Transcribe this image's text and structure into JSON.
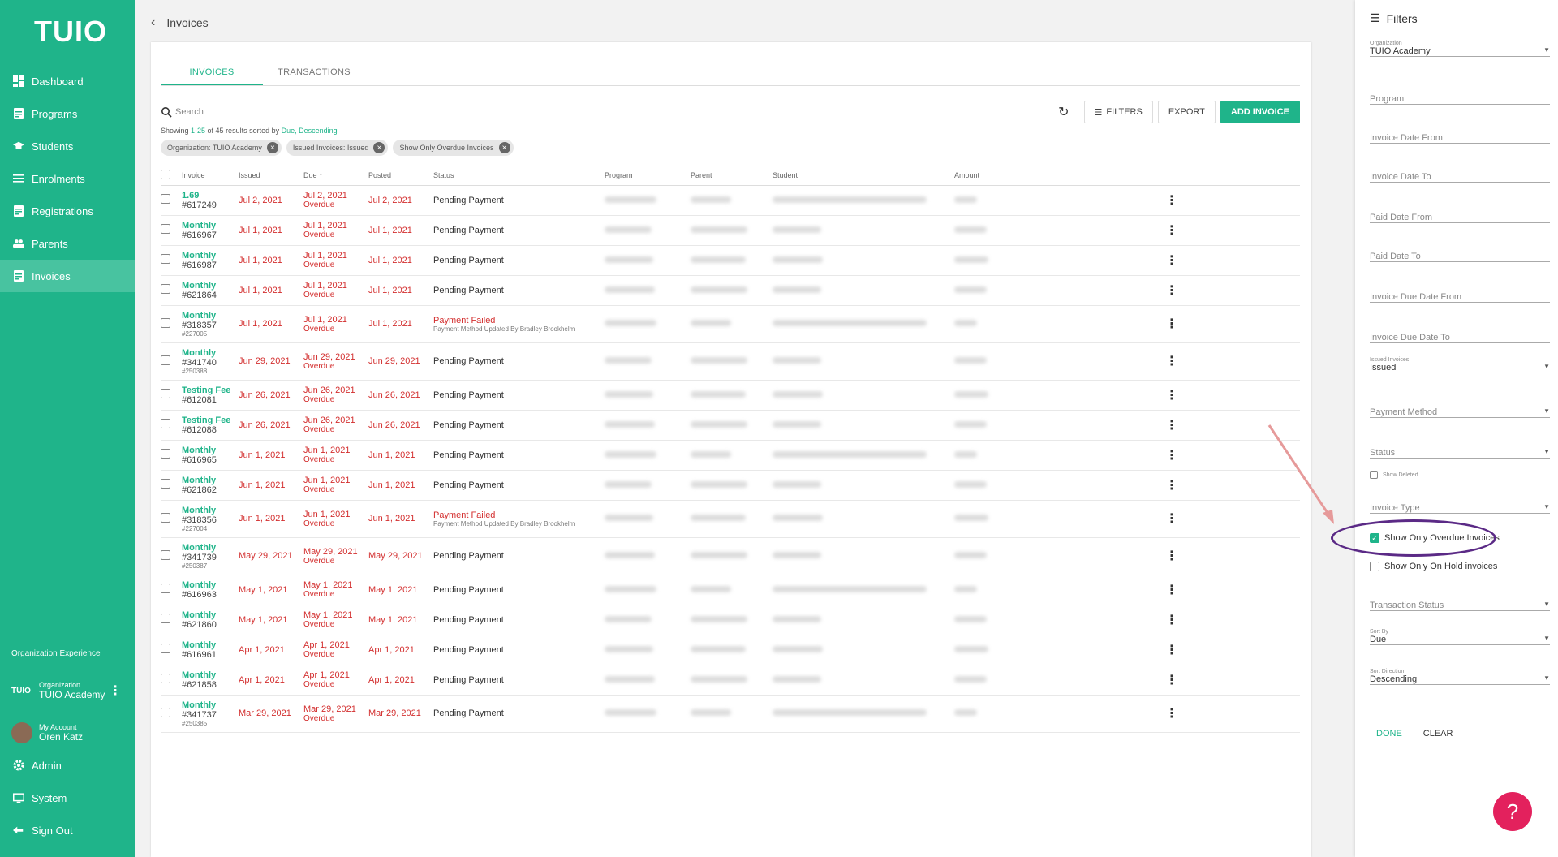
{
  "app": {
    "logo": "TUIO",
    "page_title": "Invoices"
  },
  "sidebar": {
    "items": [
      {
        "label": "Dashboard",
        "icon": "dashboard-icon"
      },
      {
        "label": "Programs",
        "icon": "document-icon"
      },
      {
        "label": "Students",
        "icon": "graduation-cap-icon"
      },
      {
        "label": "Enrolments",
        "icon": "list-icon"
      },
      {
        "label": "Registrations",
        "icon": "document-icon"
      },
      {
        "label": "Parents",
        "icon": "people-icon"
      },
      {
        "label": "Invoices",
        "icon": "document-icon",
        "active": true
      }
    ],
    "org_heading": "Organization Experience",
    "org_logo": "TUIO",
    "org_label": "Organization",
    "org_name": "TUIO Academy",
    "account_label": "My Account",
    "account_name": "Oren Katz",
    "bottom": [
      {
        "label": "Admin",
        "icon": "gear-icon"
      },
      {
        "label": "System",
        "icon": "monitor-icon"
      },
      {
        "label": "Sign Out",
        "icon": "sign-out-icon"
      }
    ]
  },
  "tabs": [
    "INVOICES",
    "TRANSACTIONS"
  ],
  "toolbar": {
    "search_placeholder": "Search",
    "filters": "FILTERS",
    "export": "EXPORT",
    "add_invoice": "ADD INVOICE"
  },
  "showing": {
    "prefix": "Showing ",
    "range": "1-25",
    "mid": " of 45 results sorted by ",
    "sort": "Due, Descending"
  },
  "chips": [
    "Organization: TUIO Academy",
    "Issued Invoices: Issued",
    "Show Only Overdue Invoices"
  ],
  "columns": [
    "Invoice",
    "Issued",
    "Due",
    "Posted",
    "Status",
    "Program",
    "Parent",
    "Student",
    "Amount"
  ],
  "due_sort_arrow": "↑",
  "overdue_label": "Overdue",
  "rows": [
    {
      "type": "1.69",
      "num": "#617249",
      "sub": "",
      "issued": "Jul 2, 2021",
      "due": "Jul 2, 2021",
      "posted": "Jul 2, 2021",
      "status": "Pending Payment",
      "status_sub": ""
    },
    {
      "type": "Monthly",
      "num": "#616967",
      "sub": "",
      "issued": "Jul 1, 2021",
      "due": "Jul 1, 2021",
      "posted": "Jul 1, 2021",
      "status": "Pending Payment",
      "status_sub": ""
    },
    {
      "type": "Monthly",
      "num": "#616987",
      "sub": "",
      "issued": "Jul 1, 2021",
      "due": "Jul 1, 2021",
      "posted": "Jul 1, 2021",
      "status": "Pending Payment",
      "status_sub": ""
    },
    {
      "type": "Monthly",
      "num": "#621864",
      "sub": "",
      "issued": "Jul 1, 2021",
      "due": "Jul 1, 2021",
      "posted": "Jul 1, 2021",
      "status": "Pending Payment",
      "status_sub": ""
    },
    {
      "type": "Monthly",
      "num": "#318357",
      "sub": "#227005",
      "issued": "Jul 1, 2021",
      "due": "Jul 1, 2021",
      "posted": "Jul 1, 2021",
      "status": "Payment Failed",
      "status_sub": "Payment Method Updated By Bradley Brookhelm"
    },
    {
      "type": "Monthly",
      "num": "#341740",
      "sub": "#250388",
      "issued": "Jun 29, 2021",
      "due": "Jun 29, 2021",
      "posted": "Jun 29, 2021",
      "status": "Pending Payment",
      "status_sub": ""
    },
    {
      "type": "Testing Fee",
      "num": "#612081",
      "sub": "",
      "issued": "Jun 26, 2021",
      "due": "Jun 26, 2021",
      "posted": "Jun 26, 2021",
      "status": "Pending Payment",
      "status_sub": ""
    },
    {
      "type": "Testing Fee",
      "num": "#612088",
      "sub": "",
      "issued": "Jun 26, 2021",
      "due": "Jun 26, 2021",
      "posted": "Jun 26, 2021",
      "status": "Pending Payment",
      "status_sub": ""
    },
    {
      "type": "Monthly",
      "num": "#616965",
      "sub": "",
      "issued": "Jun 1, 2021",
      "due": "Jun 1, 2021",
      "posted": "Jun 1, 2021",
      "status": "Pending Payment",
      "status_sub": ""
    },
    {
      "type": "Monthly",
      "num": "#621862",
      "sub": "",
      "issued": "Jun 1, 2021",
      "due": "Jun 1, 2021",
      "posted": "Jun 1, 2021",
      "status": "Pending Payment",
      "status_sub": ""
    },
    {
      "type": "Monthly",
      "num": "#318356",
      "sub": "#227004",
      "issued": "Jun 1, 2021",
      "due": "Jun 1, 2021",
      "posted": "Jun 1, 2021",
      "status": "Payment Failed",
      "status_sub": "Payment Method Updated By Bradley Brookhelm"
    },
    {
      "type": "Monthly",
      "num": "#341739",
      "sub": "#250387",
      "issued": "May 29, 2021",
      "due": "May 29, 2021",
      "posted": "May 29, 2021",
      "status": "Pending Payment",
      "status_sub": ""
    },
    {
      "type": "Monthly",
      "num": "#616963",
      "sub": "",
      "issued": "May 1, 2021",
      "due": "May 1, 2021",
      "posted": "May 1, 2021",
      "status": "Pending Payment",
      "status_sub": ""
    },
    {
      "type": "Monthly",
      "num": "#621860",
      "sub": "",
      "issued": "May 1, 2021",
      "due": "May 1, 2021",
      "posted": "May 1, 2021",
      "status": "Pending Payment",
      "status_sub": ""
    },
    {
      "type": "Monthly",
      "num": "#616961",
      "sub": "",
      "issued": "Apr 1, 2021",
      "due": "Apr 1, 2021",
      "posted": "Apr 1, 2021",
      "status": "Pending Payment",
      "status_sub": ""
    },
    {
      "type": "Monthly",
      "num": "#621858",
      "sub": "",
      "issued": "Apr 1, 2021",
      "due": "Apr 1, 2021",
      "posted": "Apr 1, 2021",
      "status": "Pending Payment",
      "status_sub": ""
    },
    {
      "type": "Monthly",
      "num": "#341737",
      "sub": "#250385",
      "issued": "Mar 29, 2021",
      "due": "Mar 29, 2021",
      "posted": "Mar 29, 2021",
      "status": "Pending Payment",
      "status_sub": ""
    }
  ],
  "filters": {
    "title": "Filters",
    "organization_label": "Organization",
    "organization_value": "TUIO Academy",
    "program": "Program",
    "invoice_date_from": "Invoice Date From",
    "invoice_date_to": "Invoice Date To",
    "paid_date_from": "Paid Date From",
    "paid_date_to": "Paid Date To",
    "due_date_from": "Invoice Due Date From",
    "due_date_to": "Invoice Due Date To",
    "issued_label": "Issued Invoices",
    "issued_value": "Issued",
    "payment_method": "Payment Method",
    "status": "Status",
    "show_deleted": "Show Deleted",
    "invoice_type": "Invoice Type",
    "show_overdue": "Show Only Overdue Invoices",
    "show_on_hold": "Show Only On Hold invoices",
    "transaction_status": "Transaction Status",
    "sort_by_label": "Sort By",
    "sort_by_value": "Due",
    "sort_dir_label": "Sort Direction",
    "sort_dir_value": "Descending",
    "done": "DONE",
    "clear": "CLEAR"
  },
  "colors": {
    "brand": "#1fb48a",
    "overdue": "#d32f2f",
    "highlight": "#5b2a86",
    "help": "#e3215d"
  }
}
